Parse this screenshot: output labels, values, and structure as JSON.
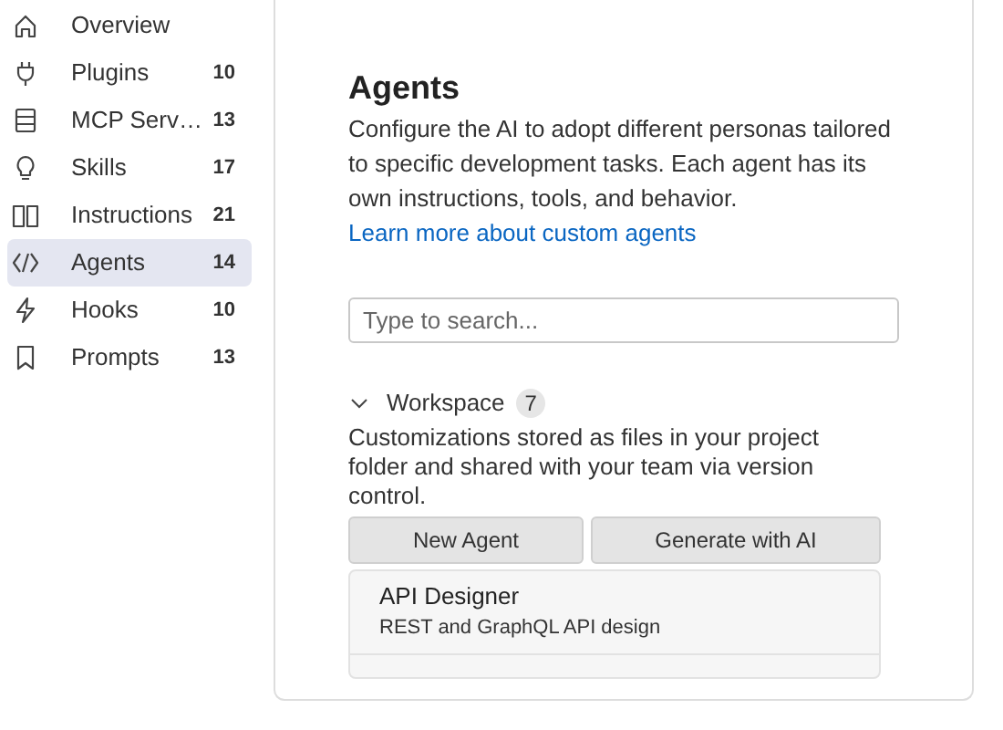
{
  "sidebar": {
    "items": [
      {
        "label": "Overview",
        "selected": false
      },
      {
        "label": "Plugins",
        "count": "10",
        "selected": false
      },
      {
        "label": "MCP Serv…",
        "count": "13",
        "selected": false
      },
      {
        "label": "Skills",
        "count": "17",
        "selected": false
      },
      {
        "label": "Instructions",
        "count": "21",
        "selected": false
      },
      {
        "label": "Agents",
        "count": "14",
        "selected": true
      },
      {
        "label": "Hooks",
        "count": "10",
        "selected": false
      },
      {
        "label": "Prompts",
        "count": "13",
        "selected": false
      }
    ]
  },
  "main": {
    "title": "Agents",
    "description": "Configure the AI to adopt different personas tailored to specific development tasks. Each agent has its own instructions, tools, and behavior.",
    "link": "Learn more about custom agents",
    "search": {
      "placeholder": "Type to search..."
    },
    "section": {
      "title": "Workspace",
      "count": "7",
      "expanded": true,
      "description": "Customizations stored as files in your project folder and shared with your team via version control.",
      "buttons": [
        "New Agent",
        "Generate with AI"
      ],
      "items": [
        {
          "name": "API Designer",
          "description": "REST and GraphQL API design"
        }
      ]
    }
  }
}
